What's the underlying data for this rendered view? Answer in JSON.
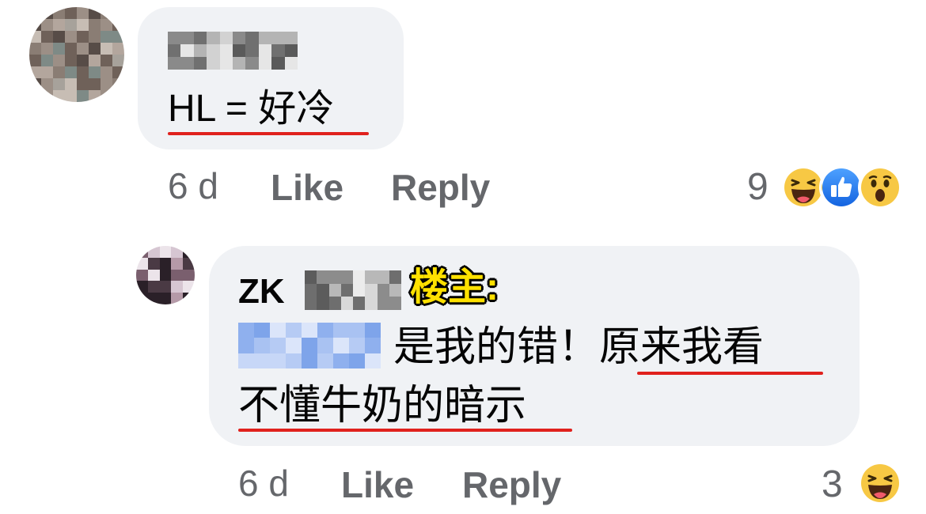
{
  "comment1": {
    "text": "HL = 好冷",
    "time": "6 d",
    "like_label": "Like",
    "reply_label": "Reply",
    "reaction_count": "9",
    "reactions": [
      "haha-icon",
      "like-icon",
      "wow-icon"
    ]
  },
  "reply1": {
    "author": "ZK",
    "badge": "楼主:",
    "text_line1": "是我的错！原来我看",
    "text_line2": "不懂牛奶的暗示",
    "time": "6 d",
    "like_label": "Like",
    "reply_label": "Reply",
    "reaction_count": "3",
    "reactions": [
      "haha-icon"
    ]
  },
  "colors": {
    "bubble": "#f0f2f5",
    "meta_text": "#65676b",
    "underline": "#e0211d",
    "badge_fill": "#ffe100",
    "like_blue": "#1877f2",
    "emoji_yellow": "#f7c844"
  }
}
